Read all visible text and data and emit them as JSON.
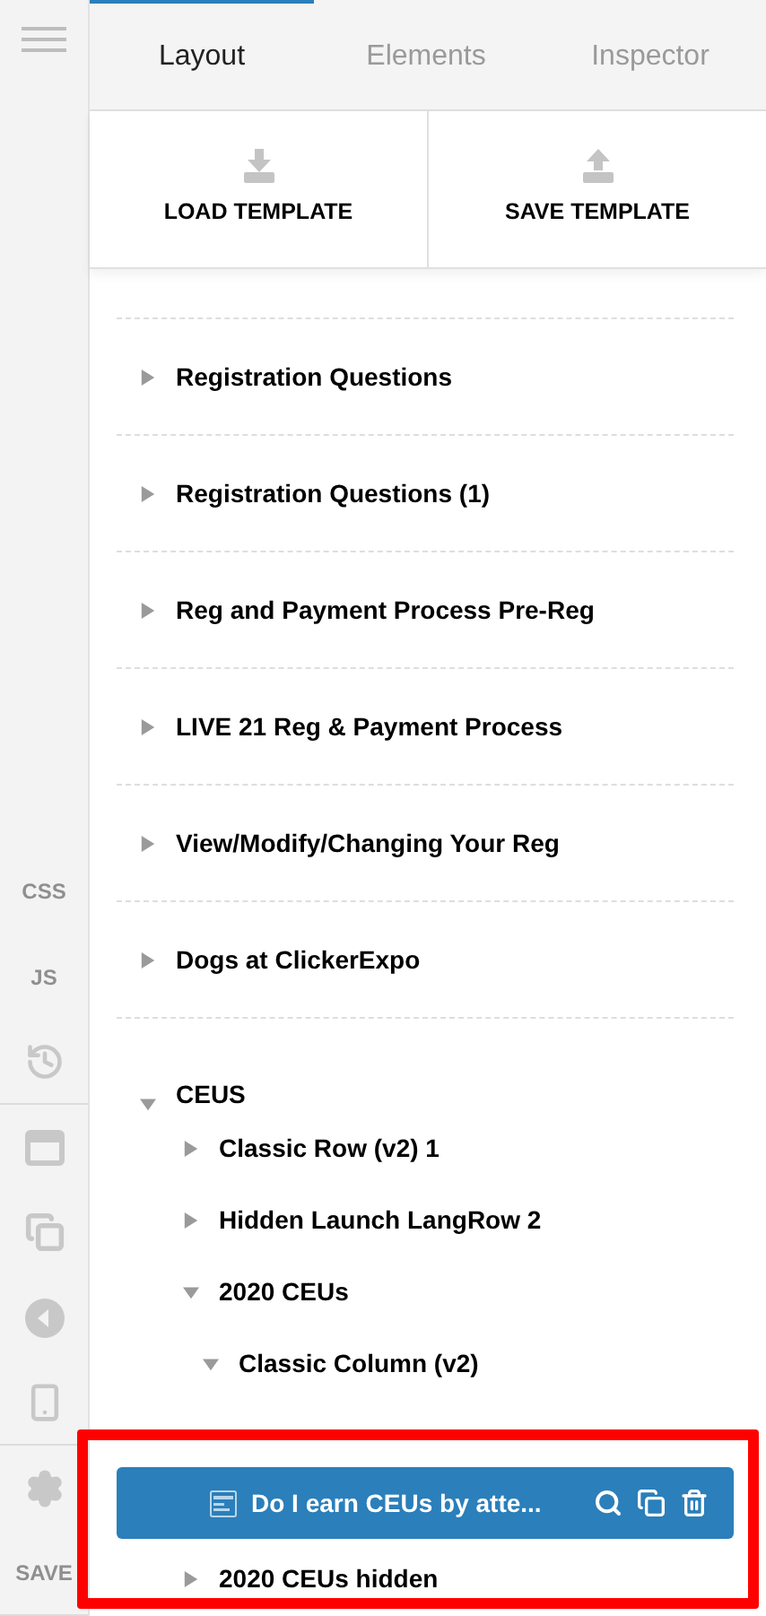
{
  "rail": [
    {
      "kind": "menu"
    },
    {
      "kind": "text",
      "label": "CSS"
    },
    {
      "kind": "text",
      "label": "JS"
    },
    {
      "kind": "history"
    },
    {
      "kind": "window"
    },
    {
      "kind": "copies"
    },
    {
      "kind": "back"
    },
    {
      "kind": "phone"
    },
    {
      "kind": "settings"
    },
    {
      "kind": "text",
      "label": "SAVE"
    }
  ],
  "tabs": [
    {
      "label": "Layout",
      "selected": true
    },
    {
      "label": "Elements",
      "selected": false
    },
    {
      "label": "Inspector",
      "selected": false
    }
  ],
  "template_buttons": [
    {
      "kind": "load",
      "label": "LOAD TEMPLATE"
    },
    {
      "kind": "save",
      "label": "SAVE TEMPLATE"
    }
  ],
  "sections": [
    {
      "label": "Registration Questions",
      "expanded": false
    },
    {
      "label": "Registration Questions (1)",
      "expanded": false
    },
    {
      "label": "Reg and Payment Process Pre-Reg",
      "expanded": false
    },
    {
      "label": "LIVE 21 Reg & Payment Process",
      "expanded": false
    },
    {
      "label": "View/Modify/Changing Your Reg",
      "expanded": false
    },
    {
      "label": "Dogs at ClickerExpo",
      "expanded": false
    },
    {
      "label": "CEUS",
      "expanded": true,
      "children": [
        {
          "label": "Classic Row (v2) 1",
          "expanded": false,
          "selected": false
        },
        {
          "label": "Hidden Launch LangRow 2",
          "expanded": false,
          "selected": false
        },
        {
          "label": "2020 CEUs",
          "expanded": true,
          "selected": false,
          "children": [
            {
              "label": "Classic Column (v2)",
              "expanded": true,
              "selected": false,
              "children": [
                {
                  "label": "Do I earn CEUs by atte...",
                  "kind": "module",
                  "selected": true
                }
              ]
            }
          ]
        },
        {
          "label": "2020 CEUs hidden",
          "expanded": false,
          "selected": false
        }
      ]
    }
  ],
  "highlight": {
    "on": true
  }
}
